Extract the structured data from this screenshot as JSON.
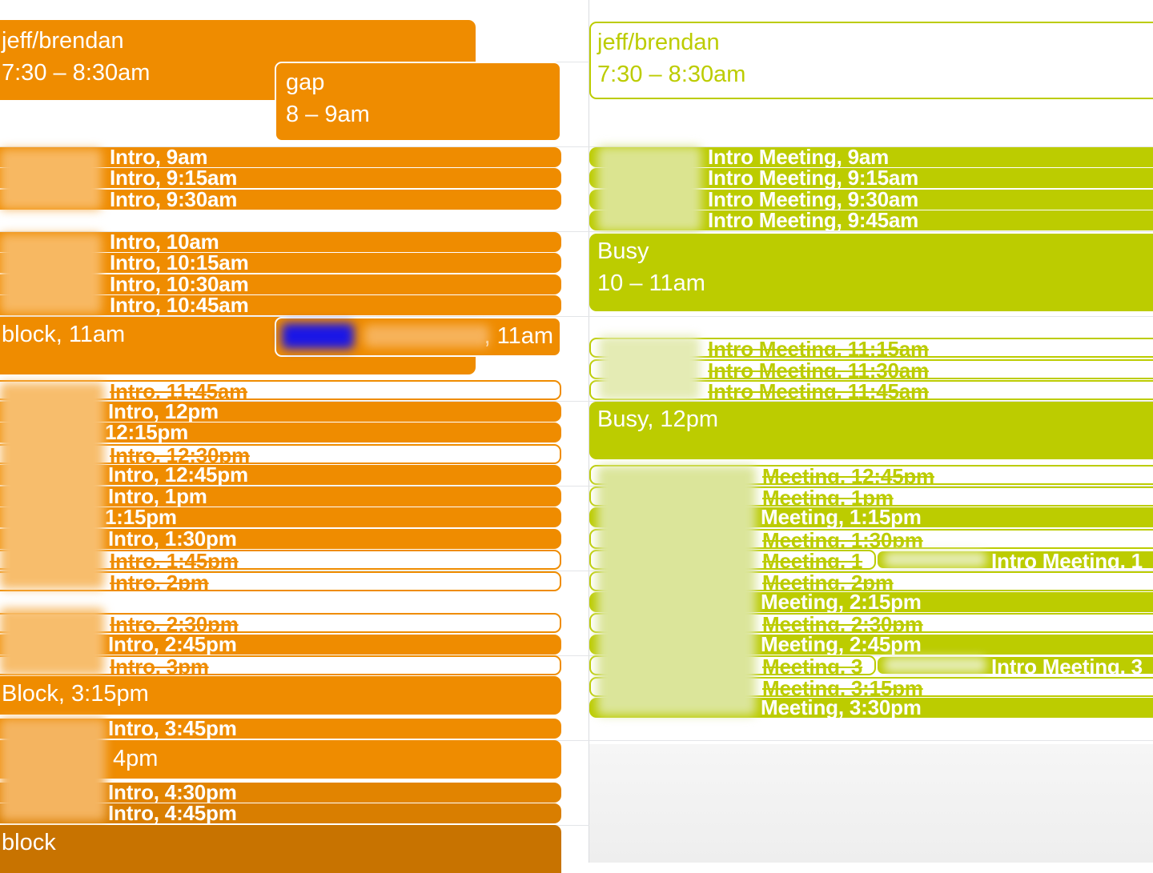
{
  "colors": {
    "orange": "#ef8c00",
    "orange_dark": "#c87300",
    "green": "#bccc00",
    "grid": "#e3e5e8",
    "blur_blue": "#1a16e6"
  },
  "left": {
    "events": [
      {
        "title": "jeff/brendan",
        "time": "7:30 – 8:30am"
      },
      {
        "title": "gap",
        "time": "8 – 9am"
      },
      {
        "title": "Intro, 9am"
      },
      {
        "title": "Intro, 9:15am"
      },
      {
        "title": "Intro, 9:30am"
      },
      {
        "title": "Intro, 10am"
      },
      {
        "title": "Intro, 10:15am"
      },
      {
        "title": "Intro, 10:30am"
      },
      {
        "title": "Intro, 10:45am"
      },
      {
        "title": "block, 11am"
      },
      {
        "title": ", 11am"
      },
      {
        "title": "Intro, 11:45am"
      },
      {
        "title": "Intro, 12pm"
      },
      {
        "title": "12:15pm"
      },
      {
        "title": "Intro, 12:30pm"
      },
      {
        "title": "Intro, 12:45pm"
      },
      {
        "title": "Intro, 1pm"
      },
      {
        "title": "1:15pm"
      },
      {
        "title": "Intro, 1:30pm"
      },
      {
        "title": "Intro, 1:45pm"
      },
      {
        "title": "Intro, 2pm"
      },
      {
        "title": "Intro, 2:30pm"
      },
      {
        "title": "Intro, 2:45pm"
      },
      {
        "title": "Intro, 3pm"
      },
      {
        "title": "Block, 3:15pm"
      },
      {
        "title": "Intro, 3:45pm"
      },
      {
        "title": "4pm"
      },
      {
        "title": "Intro, 4:30pm"
      },
      {
        "title": "Intro, 4:45pm"
      },
      {
        "title": "block"
      }
    ]
  },
  "right": {
    "events": [
      {
        "title": "jeff/brendan",
        "time": "7:30 – 8:30am"
      },
      {
        "title": "Intro Meeting, 9am"
      },
      {
        "title": "Intro Meeting, 9:15am"
      },
      {
        "title": "Intro Meeting, 9:30am"
      },
      {
        "title": "Intro Meeting, 9:45am"
      },
      {
        "title": "Busy",
        "time": "10 – 11am"
      },
      {
        "title": "Intro Meeting, 11:15am"
      },
      {
        "title": "Intro Meeting, 11:30am"
      },
      {
        "title": "Intro Meeting, 11:45am"
      },
      {
        "title": "Busy, 12pm"
      },
      {
        "title": "Meeting, 12:45pm"
      },
      {
        "title": "Meeting, 1pm"
      },
      {
        "title": "Meeting, 1:15pm"
      },
      {
        "title": "Meeting, 1:30pm"
      },
      {
        "title": "Meeting, 1"
      },
      {
        "title": "Intro Meeting, 1"
      },
      {
        "title": "Meeting, 2pm"
      },
      {
        "title": "Meeting, 2:15pm"
      },
      {
        "title": "Meeting, 2:30pm"
      },
      {
        "title": "Meeting, 2:45pm"
      },
      {
        "title": "Meeting, 3"
      },
      {
        "title": "Intro Meeting, 3"
      },
      {
        "title": "Meeting, 3:15pm"
      },
      {
        "title": "Meeting, 3:30pm"
      }
    ]
  }
}
